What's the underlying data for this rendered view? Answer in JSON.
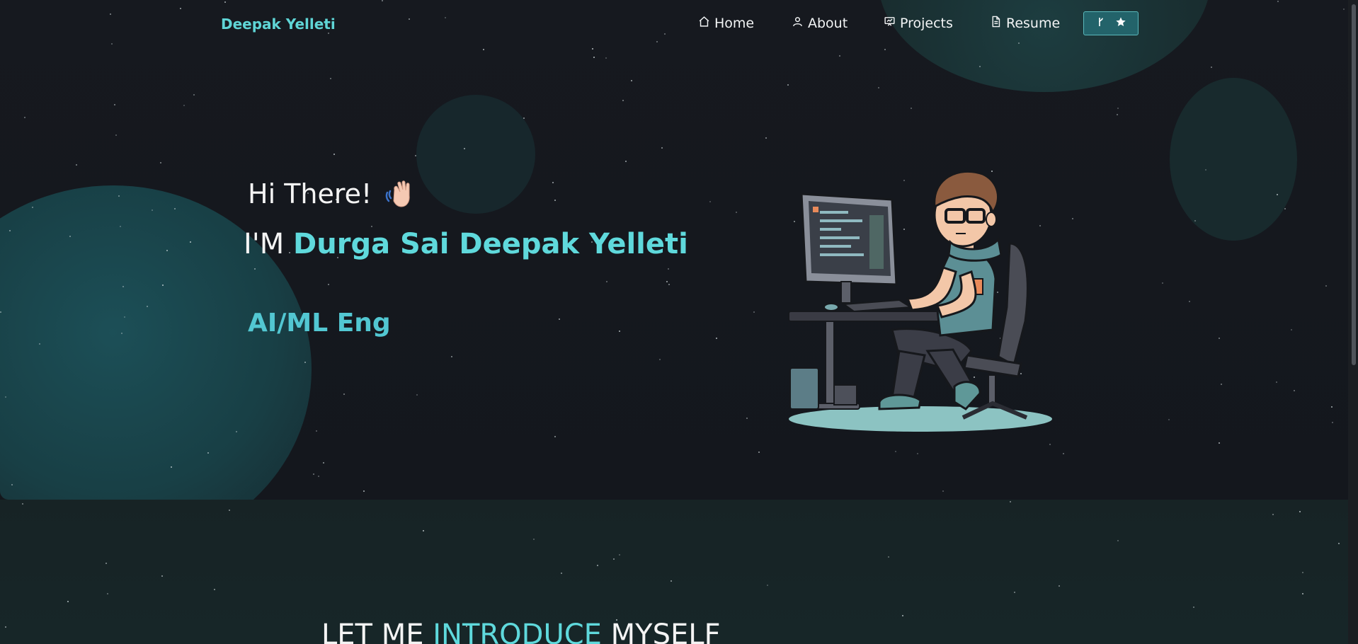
{
  "brand": "Deepak Yelleti",
  "nav": {
    "home": "Home",
    "about": "About",
    "projects": "Projects",
    "resume": "Resume"
  },
  "hero": {
    "greeting": "Hi There!",
    "intro_prefix": "I'M ",
    "name": "Durga Sai Deepak Yelleti",
    "role": "AI/ML Eng"
  },
  "section": {
    "title_prefix": "LET ME ",
    "title_accent": "INTRODUCE",
    "title_suffix": " MYSELF"
  },
  "colors": {
    "accent": "#5fd9dc",
    "background": "#14171c",
    "button": "#23636a"
  },
  "icons": [
    "home-icon",
    "user-icon",
    "projects-icon",
    "document-icon",
    "fork-icon",
    "star-icon",
    "waving-hand-icon"
  ]
}
